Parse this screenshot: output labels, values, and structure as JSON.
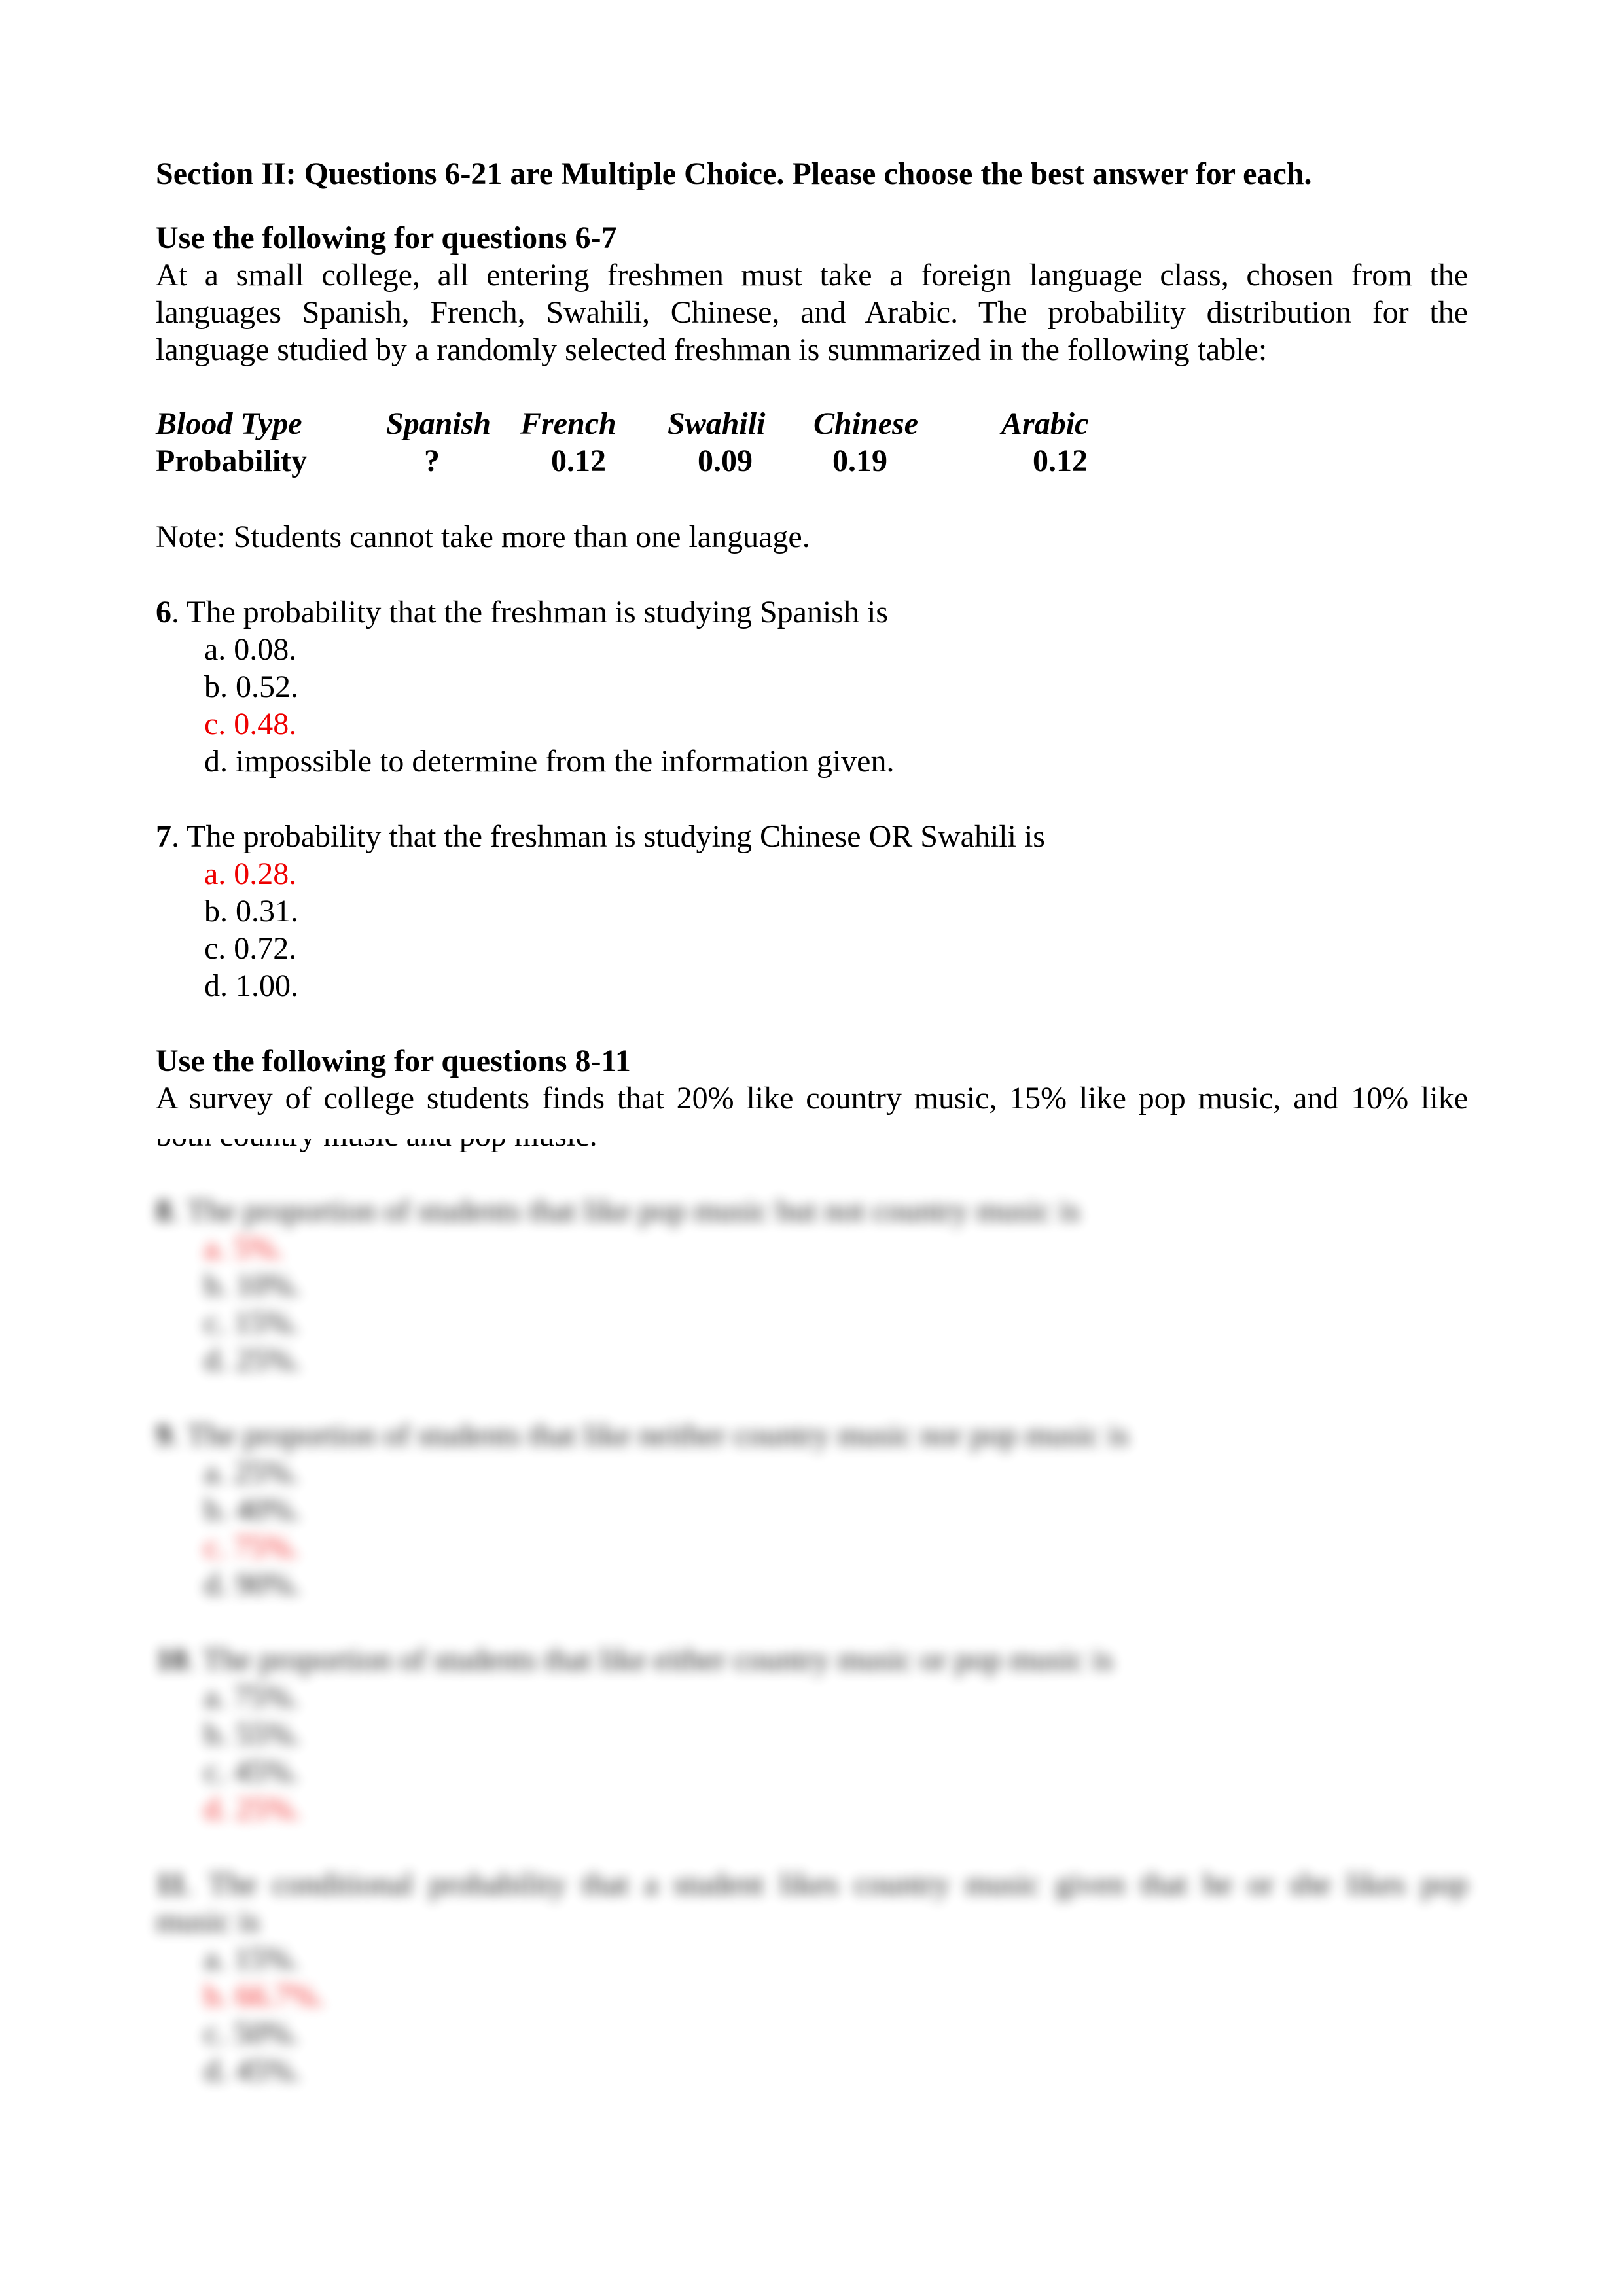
{
  "section_heading": "Section II: Questions 6-21 are Multiple Choice. Please choose the best answer for each.",
  "group1": {
    "heading": "Use the following for questions 6-7",
    "intro_lines": [
      "At a small college, all entering freshmen must take a foreign language class, chosen from the",
      "languages Spanish, French, Swahili, Chinese, and Arabic.  The probability distribution for the",
      "language studied by a randomly selected freshman is summarized in the following table:"
    ],
    "table": {
      "header_label": "Blood Type",
      "row_label": "Probability",
      "columns": [
        "Spanish",
        "French",
        "Swahili",
        "Chinese",
        "Arabic"
      ],
      "values": [
        "?",
        "0.12",
        "0.09",
        "0.19",
        "0.12"
      ]
    },
    "note": "Note: Students cannot take more than one language."
  },
  "questions": [
    {
      "number": "6",
      "text": ". The probability that the freshman is studying Spanish is",
      "options": [
        {
          "label": "a. 0.08.",
          "highlighted": false
        },
        {
          "label": "b. 0.52.",
          "highlighted": false
        },
        {
          "label": "c. 0.48.",
          "highlighted": true
        },
        {
          "label": "d. impossible to determine from the information given.",
          "highlighted": false
        }
      ]
    },
    {
      "number": "7",
      "text": ". The probability that the freshman is studying Chinese OR Swahili is",
      "options": [
        {
          "label": "a.  0.28.",
          "highlighted": true
        },
        {
          "label": "b.  0.31.",
          "highlighted": false
        },
        {
          "label": "c.  0.72.",
          "highlighted": false
        },
        {
          "label": "d. 1.00.",
          "highlighted": false
        }
      ]
    }
  ],
  "group2": {
    "heading": "Use the following for questions 8-11",
    "intro_lines": [
      "A survey of college students finds that 20% like country music, 15% like pop music, and 10% like",
      "both country music and pop music."
    ]
  },
  "blurred_questions": [
    {
      "number": "8",
      "text": ". The proportion of students that like pop music but not country music is",
      "options": [
        {
          "label": "a. 5%.",
          "highlighted": true
        },
        {
          "label": "b. 10%.",
          "highlighted": false
        },
        {
          "label": "c. 15%.",
          "highlighted": false
        },
        {
          "label": "d. 25%.",
          "highlighted": false
        }
      ]
    },
    {
      "number": "9",
      "text": ". The proportion of students that like neither country music nor pop music is",
      "options": [
        {
          "label": "a. 25%.",
          "highlighted": false
        },
        {
          "label": "b. 40%.",
          "highlighted": false
        },
        {
          "label": "c. 75%.",
          "highlighted": true
        },
        {
          "label": "d. 90%.",
          "highlighted": false
        }
      ]
    },
    {
      "number": "10",
      "text": ". The proportion of students that like either country music or pop music is",
      "options": [
        {
          "label": "a. 75%.",
          "highlighted": false
        },
        {
          "label": "b. 55%.",
          "highlighted": false
        },
        {
          "label": "c. 45%.",
          "highlighted": false
        },
        {
          "label": "d. 25%.",
          "highlighted": true
        }
      ]
    },
    {
      "number": "11",
      "text": ". The conditional probability that a student likes country music given that he or she likes pop",
      "text_cont": "music is",
      "options": [
        {
          "label": "a. 15%.",
          "highlighted": false
        },
        {
          "label": "b. 66.7%.",
          "highlighted": true
        },
        {
          "label": "c. 50%.",
          "highlighted": false
        },
        {
          "label": "d. 45%.",
          "highlighted": false
        }
      ]
    }
  ],
  "colors": {
    "answer_highlight": "#ee0000",
    "text": "#000000"
  }
}
